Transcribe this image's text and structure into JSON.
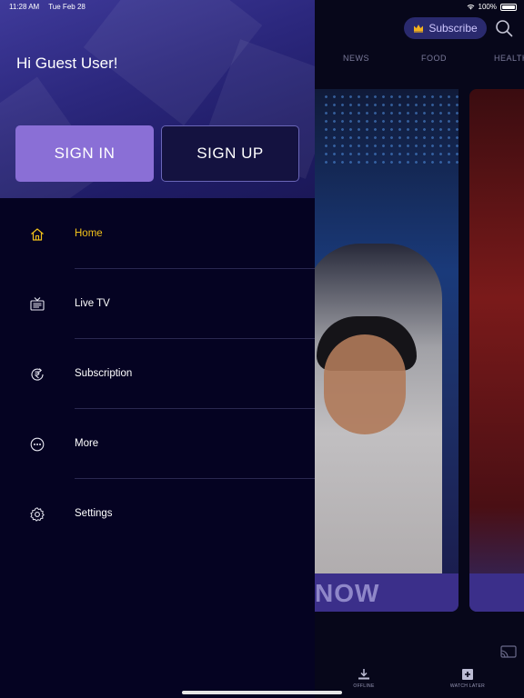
{
  "status_bar": {
    "time": "11:28 AM",
    "date": "Tue Feb 28",
    "battery": "100%"
  },
  "background": {
    "subscribe_label": "Subscribe",
    "categories": [
      "NEWS",
      "FOOD",
      "HEALTH"
    ],
    "banner_text": "NOW",
    "bottom_tabs": [
      {
        "label": "OFFLINE",
        "icon": "download-icon"
      },
      {
        "label": "WATCH LATER",
        "icon": "watch-later-icon"
      }
    ]
  },
  "drawer": {
    "greeting": "Hi Guest User!",
    "sign_in_label": "SIGN IN",
    "sign_up_label": "SIGN UP",
    "menu": [
      {
        "label": "Home",
        "icon": "home-icon",
        "active": true
      },
      {
        "label": "Live TV",
        "icon": "tv-icon",
        "active": false
      },
      {
        "label": "Subscription",
        "icon": "rupee-icon",
        "active": false
      },
      {
        "label": "More",
        "icon": "more-icon",
        "active": false
      },
      {
        "label": "Settings",
        "icon": "gear-icon",
        "active": false
      }
    ]
  },
  "colors": {
    "accent_active": "#f2c21a",
    "sign_in_bg": "#8a6fd6",
    "drawer_bg": "#050322",
    "header_bg": "#2c287e"
  }
}
